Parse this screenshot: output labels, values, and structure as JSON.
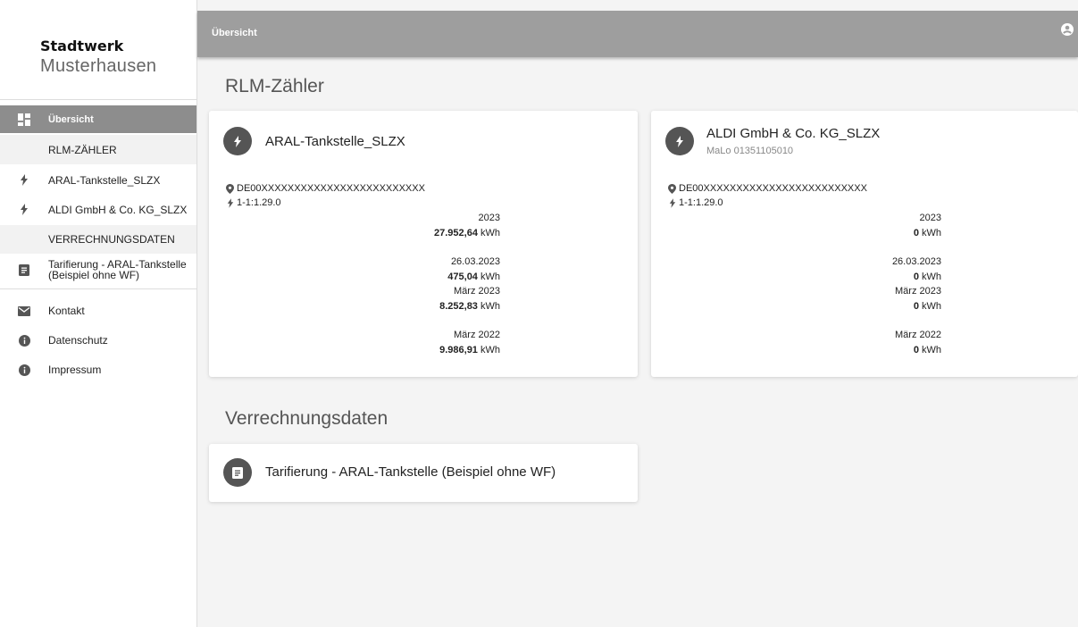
{
  "brand": {
    "line1": "Stadtwerk",
    "line2": "Musterhausen"
  },
  "sidebar": {
    "overview": "Übersicht",
    "section_rlm": "RLM-ZÄHLER",
    "meter1": "ARAL-Tankstelle_SLZX",
    "meter2": "ALDI GmbH & Co. KG_SLZX",
    "section_billing": "VERRECHNUNGSDATEN",
    "tariff_line1": "Tarifierung - ARAL-Tankstelle",
    "tariff_line2": "(Beispiel ohne WF)",
    "contact": "Kontakt",
    "privacy": "Datenschutz",
    "imprint": "Impressum"
  },
  "topbar": {
    "title": "Übersicht"
  },
  "main": {
    "rlm_heading": "RLM-Zähler",
    "billing_heading": "Verrechnungsdaten",
    "unit": "kWh",
    "cards": [
      {
        "title": "ARAL-Tankstelle_SLZX",
        "subtitle": "",
        "malo_id": "DE00XXXXXXXXXXXXXXXXXXXXXXXXX",
        "obis": "1-1:1.29.0",
        "year_label": "2023",
        "year_value": "27.952,64",
        "day_label": "26.03.2023",
        "day_value": "475,04",
        "month_label": "März 2023",
        "month_value": "8.252,83",
        "prev_month_label": "März 2022",
        "prev_month_value": "9.986,91"
      },
      {
        "title": "ALDI GmbH & Co. KG_SLZX",
        "subtitle": "MaLo 01351105010",
        "malo_id": "DE00XXXXXXXXXXXXXXXXXXXXXXXXX",
        "obis": "1-1:1.29.0",
        "year_label": "2023",
        "year_value": "0",
        "day_label": "26.03.2023",
        "day_value": "0",
        "month_label": "März 2023",
        "month_value": "0",
        "prev_month_label": "März 2022",
        "prev_month_value": "0"
      }
    ],
    "billing_card": {
      "title": "Tarifierung - ARAL-Tankstelle (Beispiel ohne WF)"
    }
  },
  "icons": {
    "overview": "dashboard-icon",
    "meter": "bolt-icon",
    "billing": "document-icon",
    "contact": "mail-icon",
    "info": "info-icon",
    "location": "location-pin-icon",
    "account": "account-circle-icon"
  }
}
